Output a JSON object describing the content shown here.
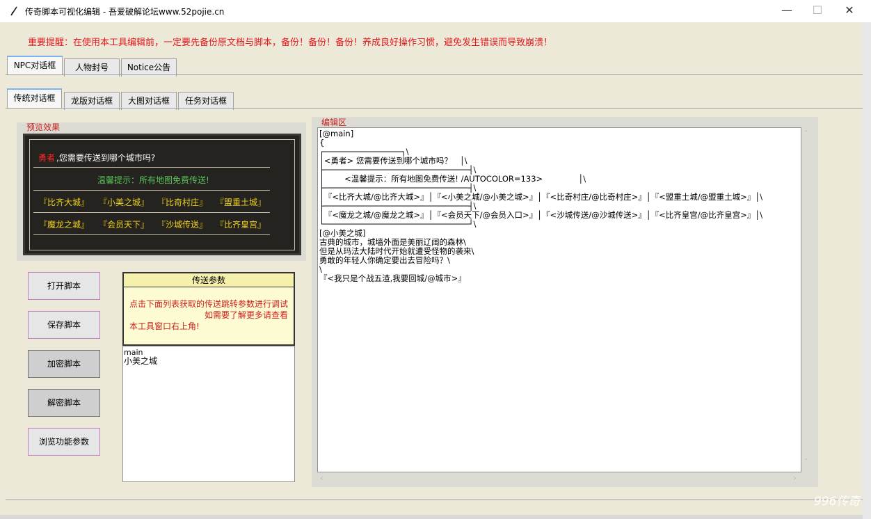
{
  "window": {
    "title": "传奇脚本可视化编辑 - 吾爱破解论坛www.52pojie.cn",
    "minimize": "—",
    "maximize": "☐",
    "close": "✕"
  },
  "warning": "重要提醒：在使用本工具编辑前，一定要先备份原文档与脚本，备份！备份！备份！养成良好操作习惯，避免发生错误而导致崩溃！",
  "main_tabs": [
    "NPC对话框",
    "人物封号",
    "Notice公告"
  ],
  "sub_tabs": [
    "传统对话框",
    "龙版对话框",
    "大图对话框",
    "任务对话框"
  ],
  "preview": {
    "label": "预览效果",
    "hero": "勇者",
    "question": ",您需要传送到哪个城市吗?",
    "tip": "温馨提示：所有地图免费传送!",
    "row1": [
      "『比齐大城』",
      "『小美之城』",
      "『比奇村庄』",
      "『盟重土城』"
    ],
    "row2": [
      "『魔龙之城』",
      "『会员天下』",
      "『沙城传送』",
      "『比齐皇宫』"
    ]
  },
  "buttons": {
    "open": "打开脚本",
    "save": "保存脚本",
    "encrypt": "加密脚本",
    "decrypt": "解密脚本",
    "browse": "浏览功能参数"
  },
  "params": {
    "title": "传送参数",
    "note_line1": "点击下面列表获取的传送跳转参数进行调试",
    "note_line2": "如需要了解更多请查看",
    "note_line3": "本工具窗口右上角!",
    "list": [
      "main",
      "小美之城"
    ]
  },
  "editor": {
    "label": "编辑区",
    "code": "[@main]\n{\n┌────────────────┐\\\n│<勇者> 您需要传送到哪个城市吗？   │\\\n├──────────────────────────────┤\\\n│        <温馨提示：所有地图免费传送! /AUTOCOLOR=133>              │\\\n├──────────────────────────────┤\\\n│『<比齐大城/@比齐大城>』│『<小美之城/@小美之城>』│『<比奇村庄/@比奇村庄>』│『<盟重土城/@盟重土城>』│\\\n├──────────────────────────────┤\\\n│『<魔龙之城/@魔龙之城>』│『<会员天下/@会员入口>』│『<沙城传送/@沙城传送>』│『<比齐皇宫/@比齐皇宫>』│\\\n└──────────────────────────────┘\\\n[@小美之城]\n古典的城市，城墙外面是美丽辽阔的森林\\\n但是从玛法大陆时代开始就遭受怪物的袭来\\\n勇敢的年轻人你确定要出去冒险吗？\\\n\\\n『<我只是个战五渣,我要回城/@城市>』"
  },
  "watermark": "996传奇"
}
